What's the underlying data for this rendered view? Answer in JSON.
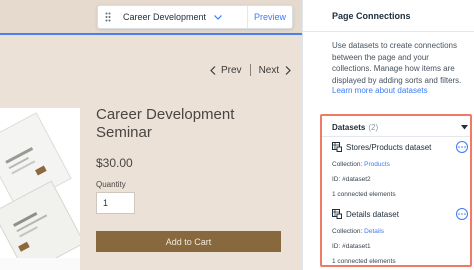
{
  "toolbar": {
    "page_name": "Career Development Sem...",
    "preview_label": "Preview"
  },
  "pager": {
    "prev_label": "Prev",
    "next_label": "Next"
  },
  "product": {
    "title": "Career Development Seminar",
    "price": "$30.00",
    "quantity_label": "Quantity",
    "quantity_value": "1",
    "add_to_cart_label": "Add to Cart"
  },
  "panel": {
    "title": "Page Connections",
    "description": "Use datasets to create connections between the page and your collections. Manage how items are displayed by adding sorts and filters.",
    "learn_more": "Learn more about datasets",
    "datasets": {
      "title": "Datasets",
      "count": "(2)",
      "items": [
        {
          "name": "Stores/Products dataset",
          "collection_label": "Collection:",
          "collection_value": "Products",
          "id_text": "ID: #dataset2",
          "connected": "1 connected elements"
        },
        {
          "name": "Details dataset",
          "collection_label": "Collection:",
          "collection_value": "Details",
          "id_text": "ID: #dataset1",
          "connected": "1 connected elements"
        }
      ]
    }
  },
  "colors": {
    "accent": "#3b7cf5",
    "highlight_border": "#ef7b67",
    "add_to_cart_bg": "#88693d",
    "canvas_bg": "#ebe1d6"
  },
  "icons": [
    "drag-handle-icon",
    "chevron-down-icon",
    "chevron-left-icon",
    "chevron-right-icon",
    "caret-down-icon",
    "dataset-icon",
    "more-icon"
  ]
}
